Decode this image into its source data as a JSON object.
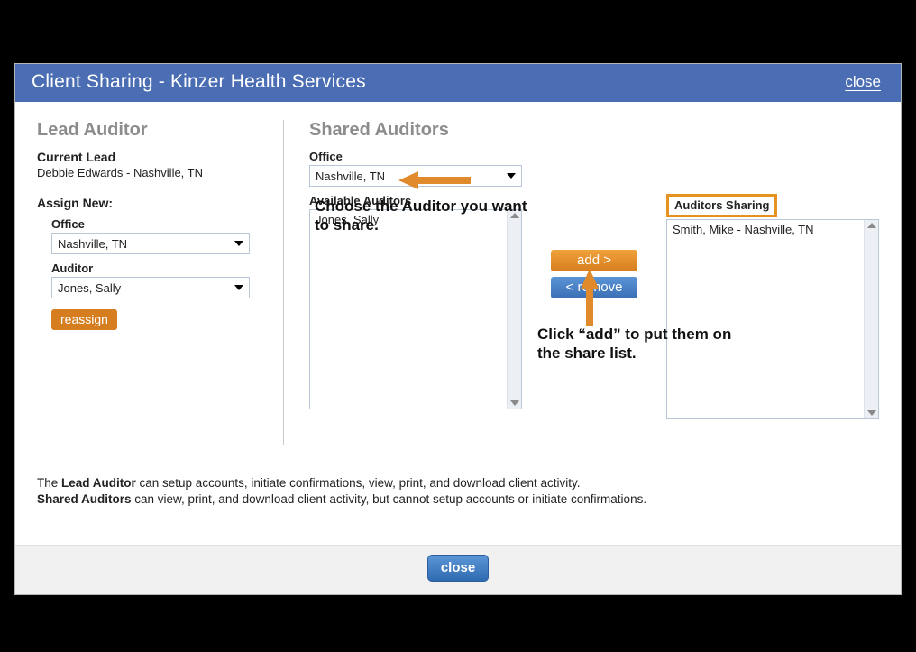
{
  "header": {
    "title": "Client Sharing - Kinzer Health Services",
    "close": "close"
  },
  "lead": {
    "section_title": "Lead Auditor",
    "current_lead_label": "Current Lead",
    "current_lead_value": "Debbie Edwards - Nashville, TN",
    "assign_new_label": "Assign New:",
    "office_label": "Office",
    "office_value": "Nashville, TN",
    "auditor_label": "Auditor",
    "auditor_value": "Jones, Sally",
    "reassign_btn": "reassign"
  },
  "shared": {
    "section_title": "Shared Auditors",
    "office_label": "Office",
    "office_value": "Nashville, TN",
    "available_label": "Available Auditors",
    "available_items": [
      "Jones, Sally"
    ],
    "sharing_label": "Auditors Sharing",
    "sharing_items": [
      "Smith, Mike - Nashville, TN"
    ],
    "add_btn": "add >",
    "remove_btn": "< remove"
  },
  "annotations": {
    "choose": "Choose the Auditor you want to share.",
    "click_add": "Click “add” to put them on the share list."
  },
  "footnote": {
    "line1_pre": "The ",
    "line1_bold": "Lead Auditor",
    "line1_post": " can setup accounts, initiate confirmations, view, print, and download client activity.",
    "line2_bold": "Shared Auditors",
    "line2_post": " can view, print, and download client activity, but cannot setup accounts or initiate confirmations."
  },
  "footer": {
    "close_btn": "close"
  }
}
